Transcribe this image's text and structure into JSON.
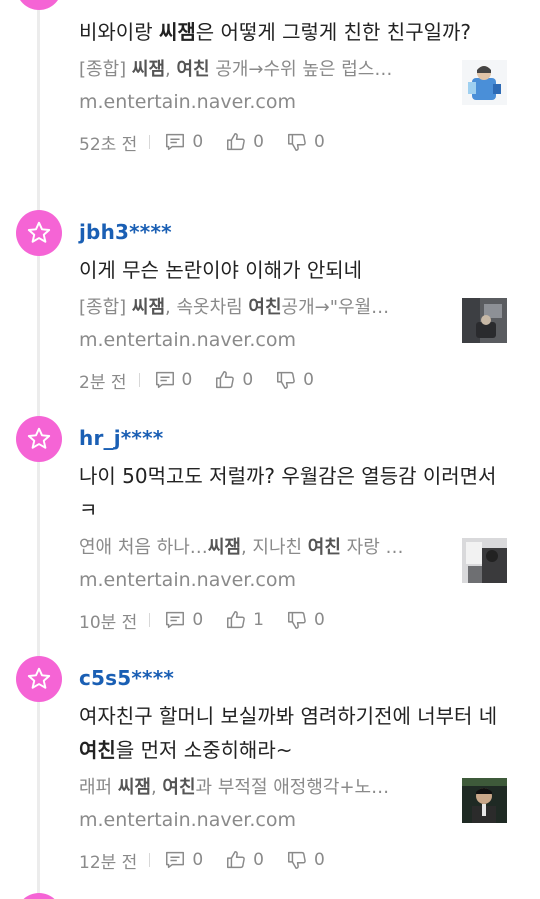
{
  "comments": [
    {
      "username": "",
      "text_parts": [
        "비와이랑 ",
        "씨잼",
        "은 어떻게 그렇게 친한 친구일까?"
      ],
      "link_parts": [
        "[종합] ",
        "씨잼",
        ", ",
        "여친",
        " 공개→수위 높은 럽스…"
      ],
      "domain": "m.entertain.naver.com",
      "time": "52초 전",
      "replies": "0",
      "likes": "0",
      "dislikes": "0"
    },
    {
      "username": "jbh3****",
      "text_parts": [
        "이게 무슨 논란이야 이해가 안되네",
        "",
        ""
      ],
      "link_parts": [
        "[종합] ",
        "씨잼",
        ", 속옷차림 ",
        "여친",
        "공개→\"우월…"
      ],
      "domain": "m.entertain.naver.com",
      "time": "2분 전",
      "replies": "0",
      "likes": "0",
      "dislikes": "0"
    },
    {
      "username": "hr_j****",
      "text_parts": [
        "나이 50먹고도 저럴까? 우월감은 열등감 이러면서 ㅋ",
        "",
        ""
      ],
      "link_parts": [
        "연애 처음 하나…",
        "씨잼",
        ", 지나친 ",
        "여친",
        " 자랑 …"
      ],
      "domain": "m.entertain.naver.com",
      "time": "10분 전",
      "replies": "0",
      "likes": "1",
      "dislikes": "0"
    },
    {
      "username": "c5s5****",
      "text_parts": [
        "여자친구 할머니 보실까봐 염려하기전에 너부터 네 ",
        "여친",
        "을 먼저 소중히해라~"
      ],
      "link_parts": [
        "래퍼 ",
        "씨잼",
        ", ",
        "여친",
        "과 부적절 애정행각+노…"
      ],
      "domain": "m.entertain.naver.com",
      "time": "12분 전",
      "replies": "0",
      "likes": "0",
      "dislikes": "0"
    }
  ],
  "icons": {
    "avatar": "star-icon",
    "reply": "speech-bubble-icon",
    "like": "thumbs-up-icon",
    "dislike": "thumbs-down-icon"
  },
  "colors": {
    "avatar_bg": "#f564d5",
    "username": "#1a5fb4",
    "meta_text": "#8a8a8a"
  }
}
